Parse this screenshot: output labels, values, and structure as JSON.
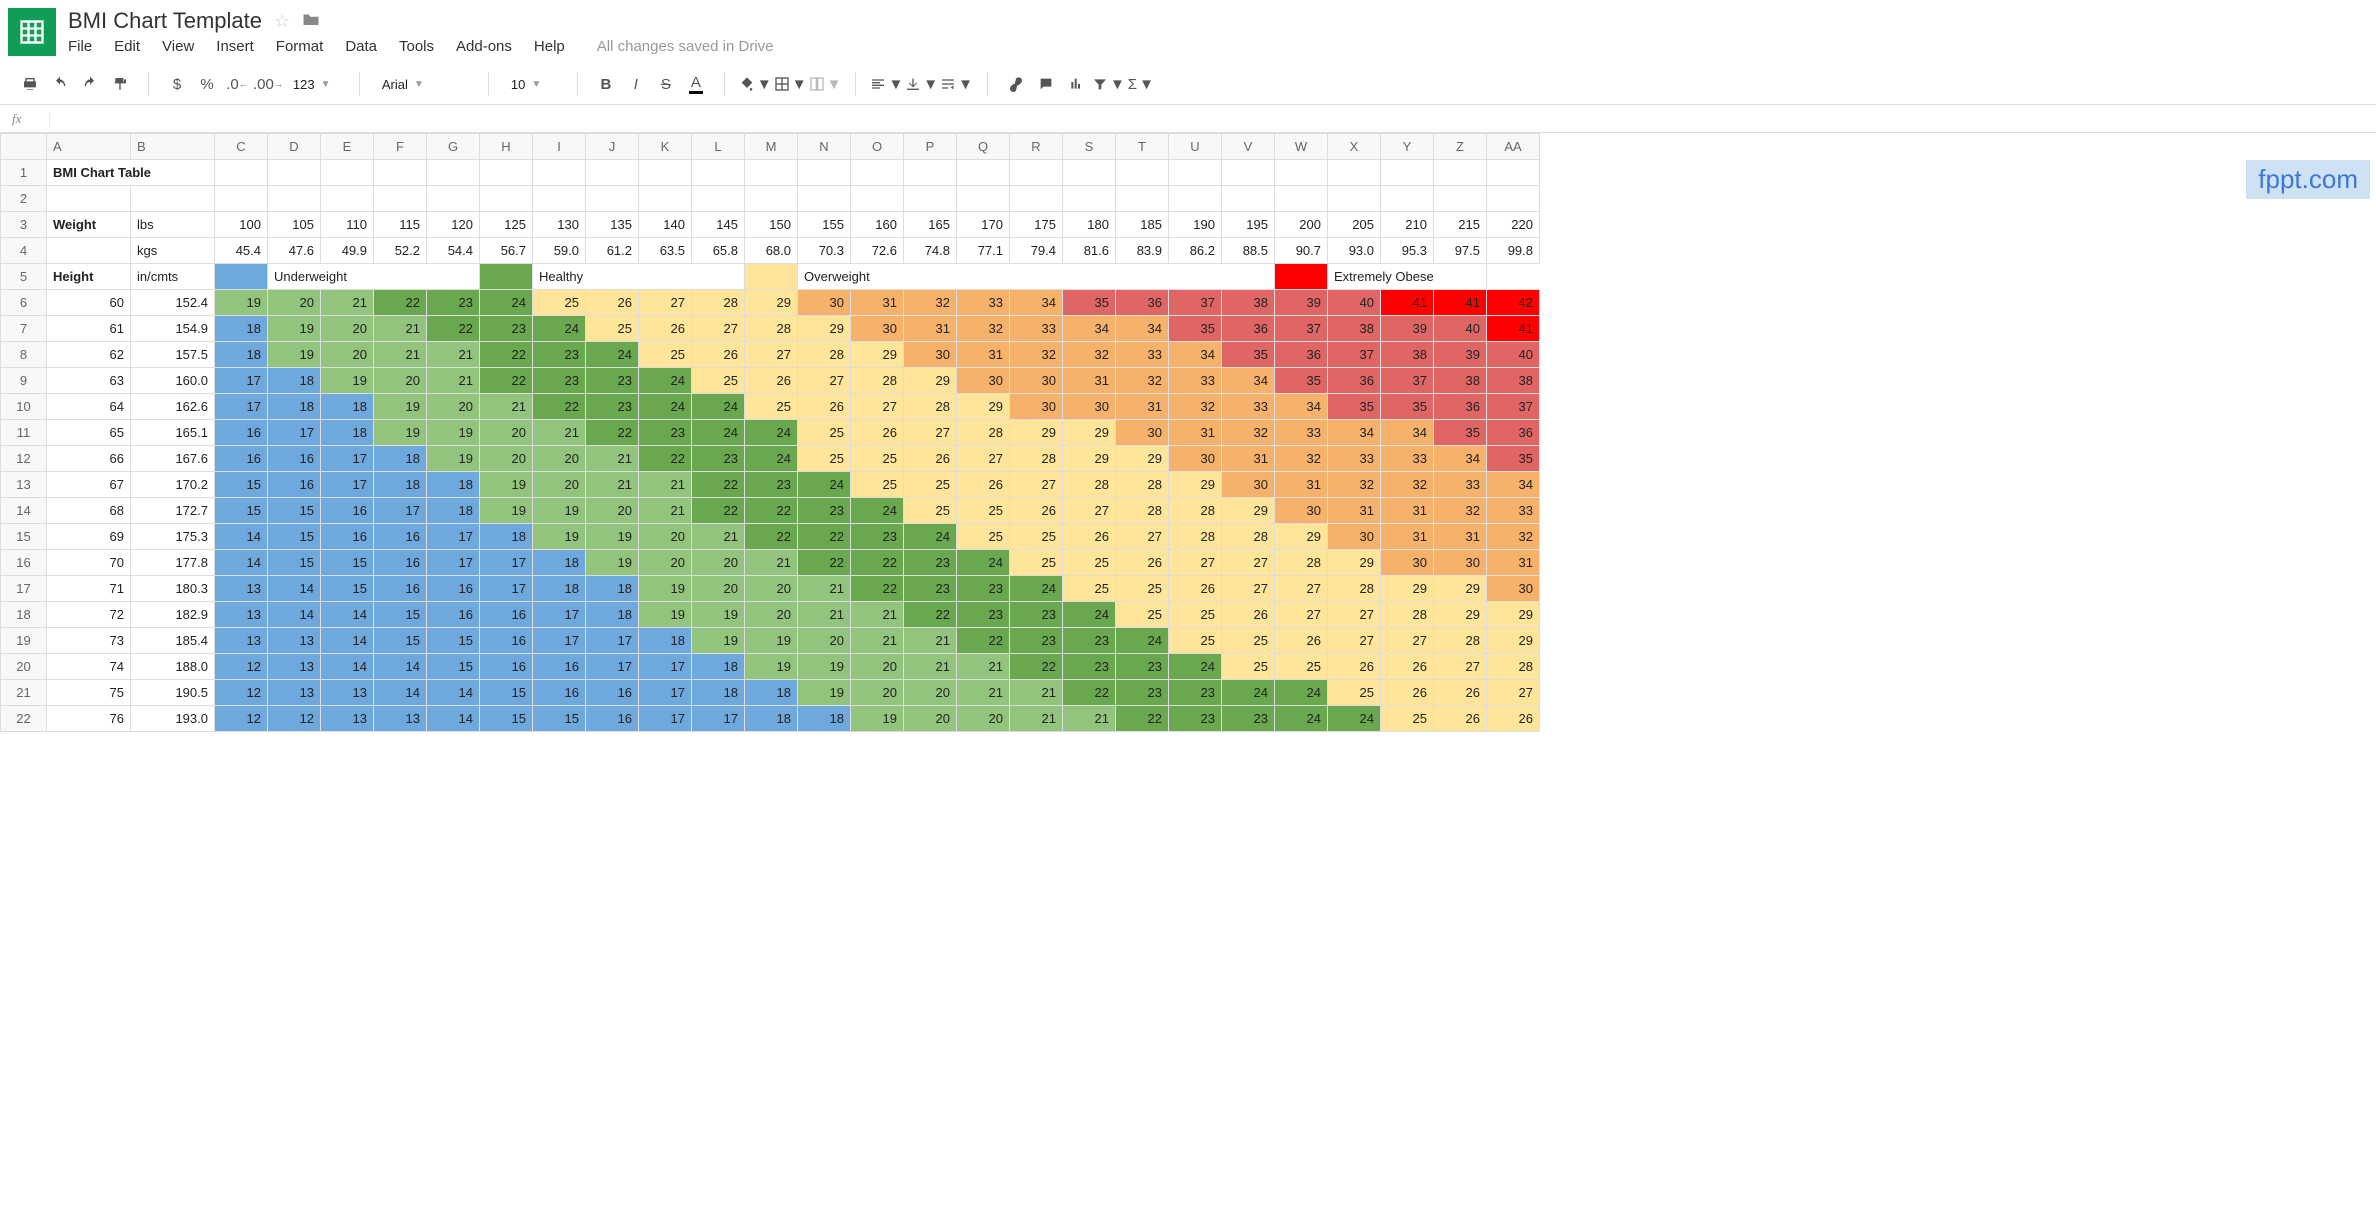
{
  "header": {
    "title": "BMI Chart Template",
    "menus": [
      "File",
      "Edit",
      "View",
      "Insert",
      "Format",
      "Data",
      "Tools",
      "Add-ons",
      "Help"
    ],
    "save_status": "All changes saved in Drive"
  },
  "toolbar": {
    "font_name": "Arial",
    "font_size": "10",
    "num_label": "123"
  },
  "formula_bar": {
    "fx": "fx"
  },
  "columns": [
    "A",
    "B",
    "C",
    "D",
    "E",
    "F",
    "G",
    "H",
    "I",
    "J",
    "K",
    "L",
    "M",
    "N",
    "O",
    "P",
    "Q",
    "R",
    "S",
    "T",
    "U",
    "V",
    "W",
    "X",
    "Y",
    "Z",
    "AA"
  ],
  "row_headers": [
    "1",
    "2",
    "3",
    "4",
    "5",
    "6",
    "7",
    "8",
    "9",
    "10",
    "11",
    "12",
    "13",
    "14",
    "15",
    "16",
    "17",
    "18",
    "19",
    "20",
    "21",
    "22"
  ],
  "watermark": "fppt.com",
  "labels": {
    "title": "BMI Chart Table",
    "weight": "Weight",
    "lbs": "lbs",
    "kgs": "kgs",
    "height": "Height",
    "incmts": "in/cmts",
    "underweight": "Underweight",
    "healthy": "Healthy",
    "overweight": "Overweight",
    "extreme": "Extremely Obese"
  },
  "weights_lbs": [
    100,
    105,
    110,
    115,
    120,
    125,
    130,
    135,
    140,
    145,
    150,
    155,
    160,
    165,
    170,
    175,
    180,
    185,
    190,
    195,
    200,
    205,
    210,
    215,
    220
  ],
  "weights_kgs": [
    45.4,
    47.6,
    49.9,
    52.2,
    54.4,
    56.7,
    59.0,
    61.2,
    63.5,
    65.8,
    68.0,
    70.3,
    72.6,
    74.8,
    77.1,
    79.4,
    81.6,
    83.9,
    86.2,
    88.5,
    90.7,
    93.0,
    95.3,
    97.5,
    99.8
  ],
  "rows": [
    {
      "in": 60,
      "cm": 152.4,
      "v": [
        19,
        20,
        21,
        22,
        23,
        24,
        25,
        26,
        27,
        28,
        29,
        30,
        31,
        32,
        33,
        34,
        35,
        36,
        37,
        38,
        39,
        40,
        41,
        41,
        42
      ]
    },
    {
      "in": 61,
      "cm": 154.9,
      "v": [
        18,
        19,
        20,
        21,
        22,
        23,
        24,
        25,
        26,
        27,
        28,
        29,
        30,
        31,
        32,
        33,
        34,
        34,
        35,
        36,
        37,
        38,
        39,
        40,
        41
      ]
    },
    {
      "in": 62,
      "cm": 157.5,
      "v": [
        18,
        19,
        20,
        21,
        21,
        22,
        23,
        24,
        25,
        26,
        27,
        28,
        29,
        30,
        31,
        32,
        32,
        33,
        34,
        35,
        36,
        37,
        38,
        39,
        40
      ]
    },
    {
      "in": 63,
      "cm": 160.0,
      "v": [
        17,
        18,
        19,
        20,
        21,
        22,
        23,
        23,
        24,
        25,
        26,
        27,
        28,
        29,
        30,
        30,
        31,
        32,
        33,
        34,
        35,
        36,
        37,
        38,
        38
      ]
    },
    {
      "in": 64,
      "cm": 162.6,
      "v": [
        17,
        18,
        18,
        19,
        20,
        21,
        22,
        23,
        24,
        24,
        25,
        26,
        27,
        28,
        29,
        30,
        30,
        31,
        32,
        33,
        34,
        35,
        35,
        36,
        37
      ]
    },
    {
      "in": 65,
      "cm": 165.1,
      "v": [
        16,
        17,
        18,
        19,
        19,
        20,
        21,
        22,
        23,
        24,
        24,
        25,
        26,
        27,
        28,
        29,
        29,
        30,
        31,
        32,
        33,
        34,
        34,
        35,
        36
      ]
    },
    {
      "in": 66,
      "cm": 167.6,
      "v": [
        16,
        16,
        17,
        18,
        19,
        20,
        20,
        21,
        22,
        23,
        24,
        25,
        25,
        26,
        27,
        28,
        29,
        29,
        30,
        31,
        32,
        33,
        33,
        34,
        35
      ]
    },
    {
      "in": 67,
      "cm": 170.2,
      "v": [
        15,
        16,
        17,
        18,
        18,
        19,
        20,
        21,
        21,
        22,
        23,
        24,
        25,
        25,
        26,
        27,
        28,
        28,
        29,
        30,
        31,
        32,
        32,
        33,
        34
      ]
    },
    {
      "in": 68,
      "cm": 172.7,
      "v": [
        15,
        15,
        16,
        17,
        18,
        19,
        19,
        20,
        21,
        22,
        22,
        23,
        24,
        25,
        25,
        26,
        27,
        28,
        28,
        29,
        30,
        31,
        31,
        32,
        33
      ]
    },
    {
      "in": 69,
      "cm": 175.3,
      "v": [
        14,
        15,
        16,
        16,
        17,
        18,
        19,
        19,
        20,
        21,
        22,
        22,
        23,
        24,
        25,
        25,
        26,
        27,
        28,
        28,
        29,
        30,
        31,
        31,
        32
      ]
    },
    {
      "in": 70,
      "cm": 177.8,
      "v": [
        14,
        15,
        15,
        16,
        17,
        17,
        18,
        19,
        20,
        20,
        21,
        22,
        22,
        23,
        24,
        25,
        25,
        26,
        27,
        27,
        28,
        29,
        30,
        30,
        31
      ]
    },
    {
      "in": 71,
      "cm": 180.3,
      "v": [
        13,
        14,
        15,
        16,
        16,
        17,
        18,
        18,
        19,
        20,
        20,
        21,
        22,
        23,
        23,
        24,
        25,
        25,
        26,
        27,
        27,
        28,
        29,
        29,
        30
      ]
    },
    {
      "in": 72,
      "cm": 182.9,
      "v": [
        13,
        14,
        14,
        15,
        16,
        16,
        17,
        18,
        19,
        19,
        20,
        21,
        21,
        22,
        23,
        23,
        24,
        25,
        25,
        26,
        27,
        27,
        28,
        29,
        29
      ]
    },
    {
      "in": 73,
      "cm": 185.4,
      "v": [
        13,
        13,
        14,
        15,
        15,
        16,
        17,
        17,
        18,
        19,
        19,
        20,
        21,
        21,
        22,
        23,
        23,
        24,
        25,
        25,
        26,
        27,
        27,
        28,
        29
      ]
    },
    {
      "in": 74,
      "cm": 188.0,
      "v": [
        12,
        13,
        14,
        14,
        15,
        16,
        16,
        17,
        17,
        18,
        19,
        19,
        20,
        21,
        21,
        22,
        23,
        23,
        24,
        25,
        25,
        26,
        26,
        27,
        28
      ]
    },
    {
      "in": 75,
      "cm": 190.5,
      "v": [
        12,
        13,
        13,
        14,
        14,
        15,
        16,
        16,
        17,
        18,
        18,
        19,
        20,
        20,
        21,
        21,
        22,
        23,
        23,
        24,
        24,
        25,
        26,
        26,
        27
      ]
    },
    {
      "in": 76,
      "cm": 193.0,
      "v": [
        12,
        12,
        13,
        13,
        14,
        15,
        15,
        16,
        17,
        17,
        18,
        18,
        19,
        20,
        20,
        21,
        21,
        22,
        23,
        23,
        24,
        24,
        25,
        26,
        26
      ]
    }
  ]
}
